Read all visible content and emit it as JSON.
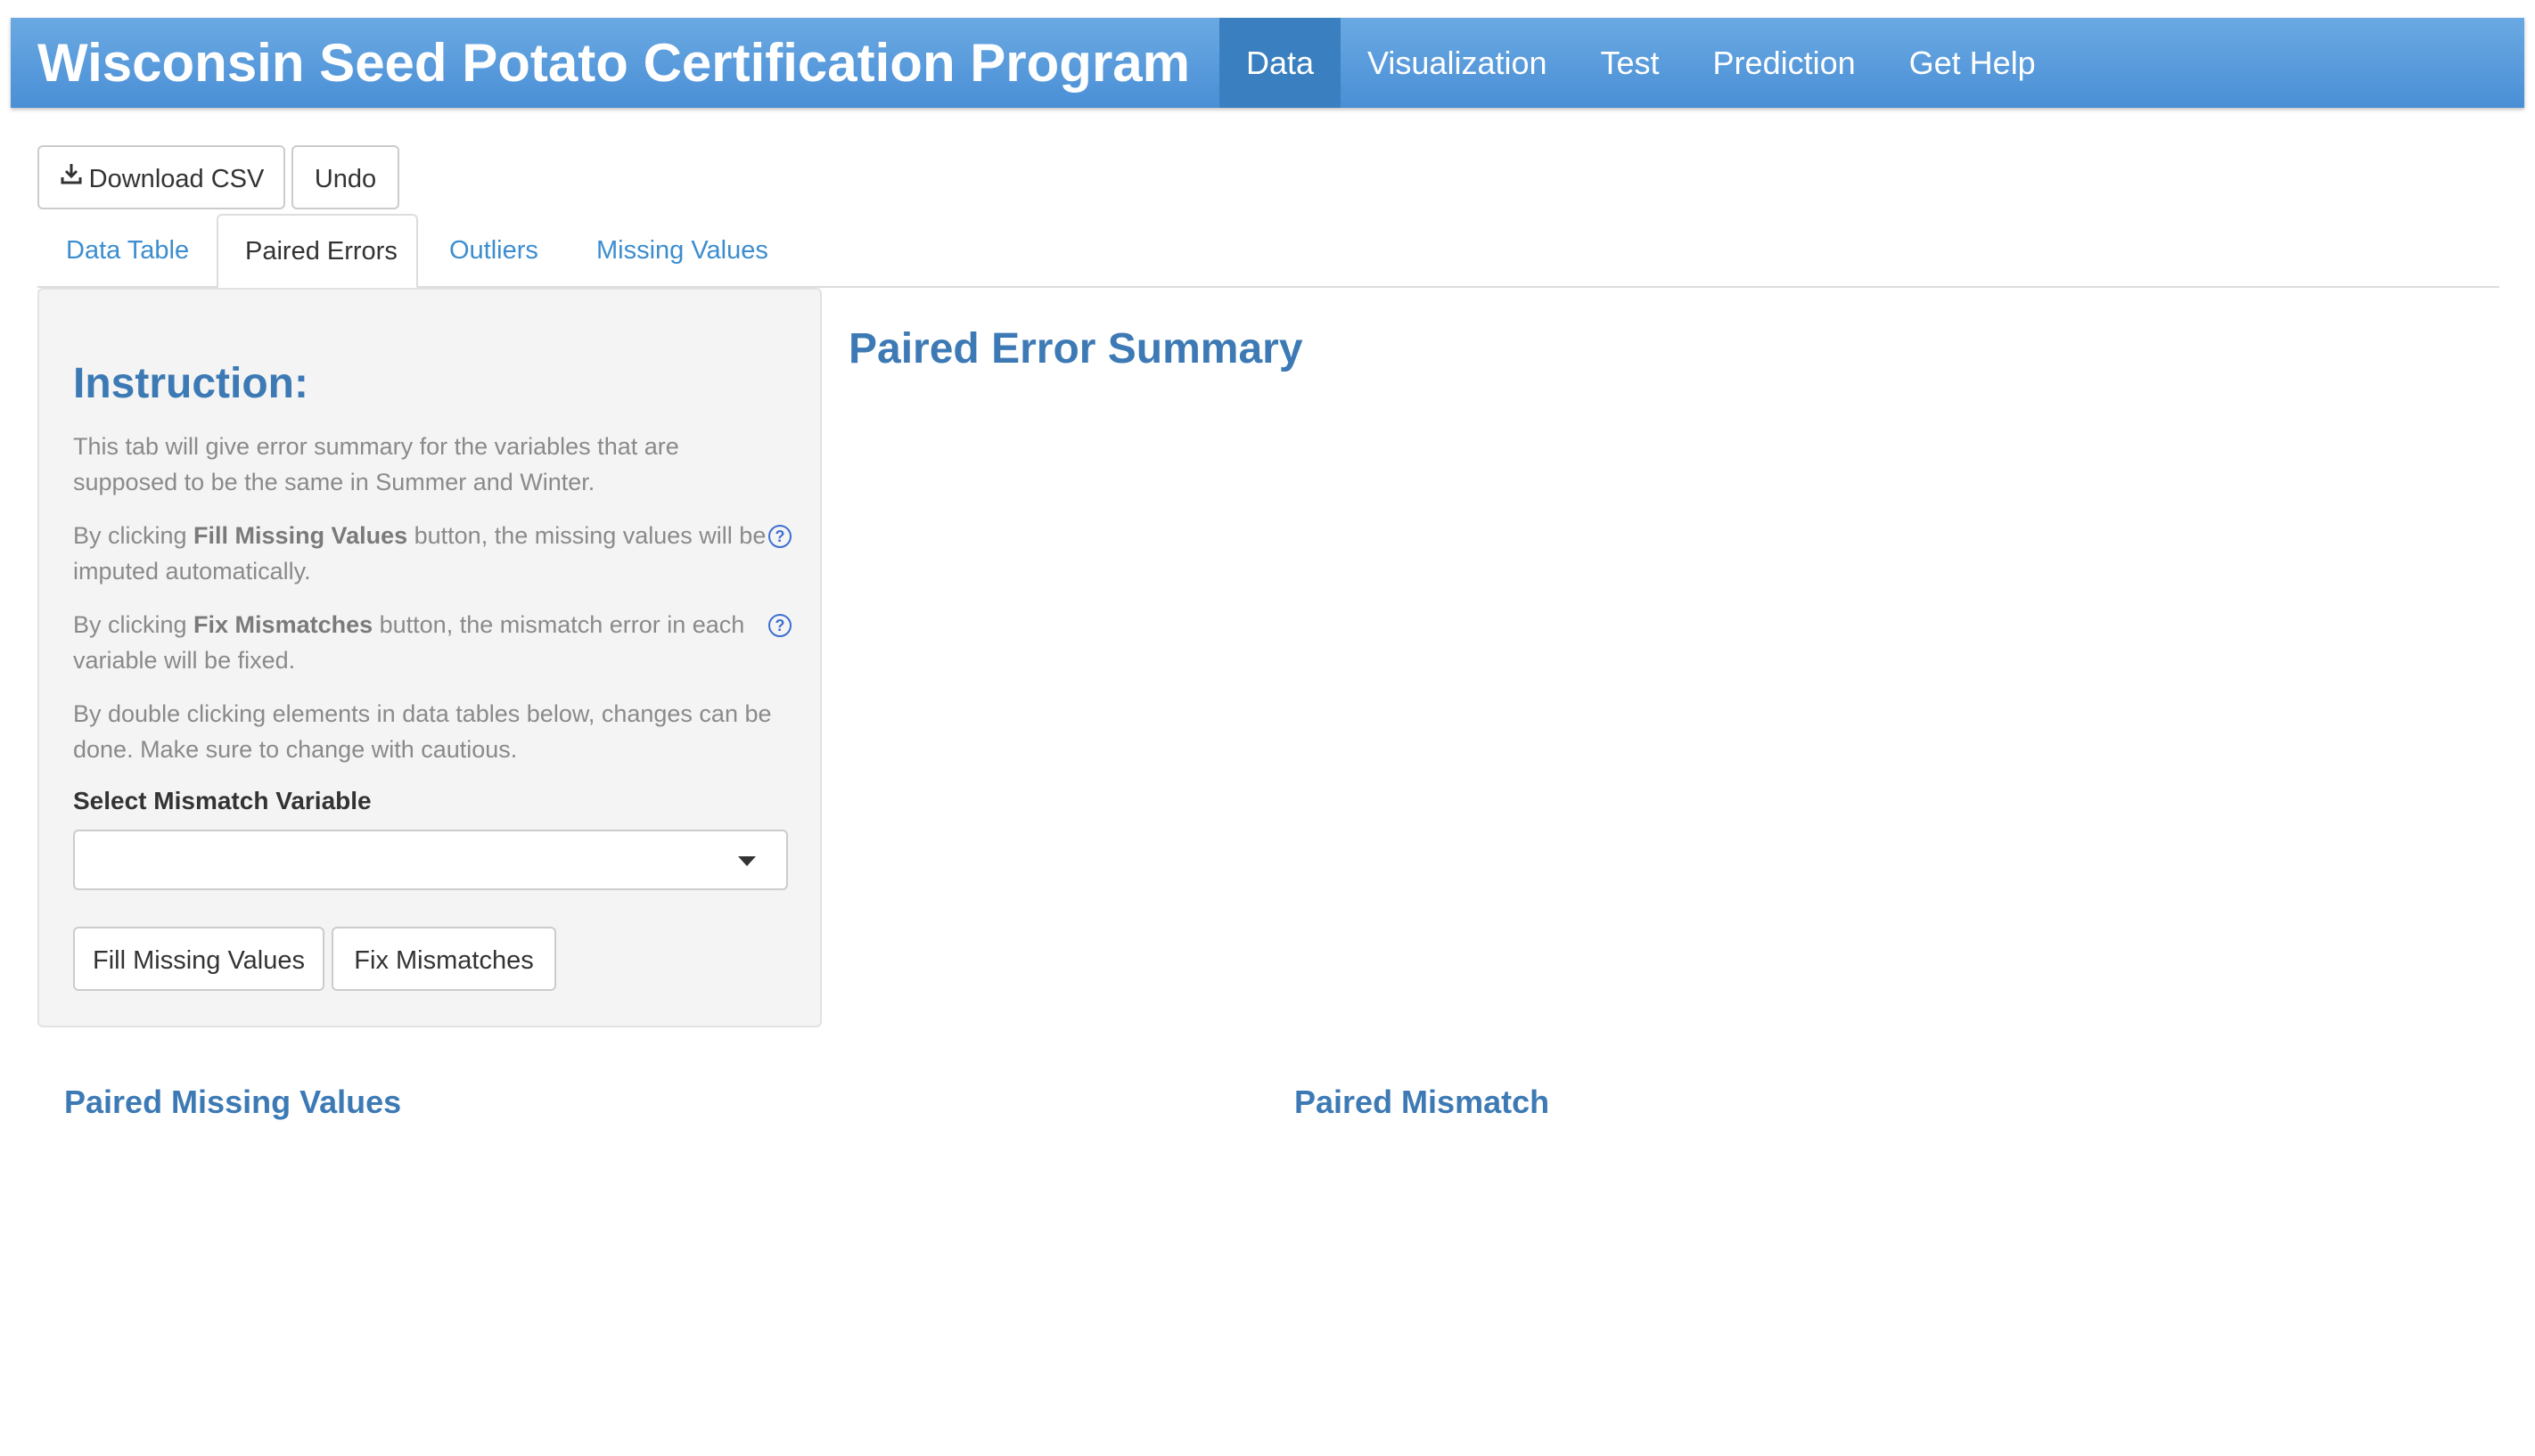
{
  "navbar": {
    "brand": "Wisconsin Seed Potato Certification Program",
    "items": [
      {
        "label": "Data",
        "active": true
      },
      {
        "label": "Visualization",
        "active": false
      },
      {
        "label": "Test",
        "active": false
      },
      {
        "label": "Prediction",
        "active": false
      },
      {
        "label": "Get Help",
        "active": false
      }
    ]
  },
  "toolbar": {
    "download_label": "Download CSV",
    "download_icon": "download-icon",
    "undo_label": "Undo"
  },
  "tabs": [
    {
      "label": "Data Table",
      "active": false
    },
    {
      "label": "Paired Errors",
      "active": true
    },
    {
      "label": "Outliers",
      "active": false
    },
    {
      "label": "Missing Values",
      "active": false
    }
  ],
  "sidebar": {
    "title": "Instruction:",
    "para1": "This tab will give error summary for the variables that are supposed to be the same in Summer and Winter.",
    "para2_prefix": "By clicking ",
    "para2_bold": "Fill Missing Values",
    "para2_suffix": " button, the missing values will be imputed automatically.",
    "para3_prefix": "By clicking ",
    "para3_bold": "Fix Mismatches",
    "para3_suffix": " button, the mismatch error in each variable will be fixed.",
    "para4": "By double clicking elements in data tables below, changes can be done. Make sure to change with cautious.",
    "help_glyph": "?",
    "select_label": "Select Mismatch Variable",
    "select_value": "",
    "fill_button": "Fill Missing Values",
    "fix_button": "Fix Mismatches"
  },
  "main": {
    "summary_title": "Paired Error Summary",
    "missing_title": "Paired Missing Values",
    "mismatch_title": "Paired Mismatch"
  },
  "colors": {
    "navbar": "#4a8fd6",
    "navbar_active": "#3a7fc0",
    "heading": "#3d7ab5",
    "link": "#3c8dcf"
  }
}
